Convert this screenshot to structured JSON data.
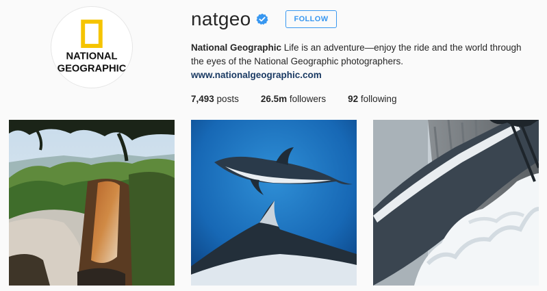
{
  "profile": {
    "username": "natgeo",
    "follow_label": "FOLLOW",
    "full_name": "National Geographic",
    "bio_text": " Life is an adventure—enjoy the ride and the world through the eyes of the National Geographic photographers. ",
    "website": "www.nationalgeographic.com",
    "avatar": {
      "line1": "NATIONAL",
      "line2": "GEOGRAPHIC"
    }
  },
  "stats": {
    "posts_count": "7,493",
    "posts_label": " posts",
    "followers_count": "26.5m",
    "followers_label": " followers",
    "following_count": "92",
    "following_label": " following"
  },
  "colors": {
    "accent": "#3897f0",
    "link": "#1a3a63",
    "logo_yellow": "#f5c400"
  },
  "posts": [
    {
      "name": "waterfall-photo"
    },
    {
      "name": "dolphins-photo"
    },
    {
      "name": "snowy-cliff-photo"
    }
  ]
}
